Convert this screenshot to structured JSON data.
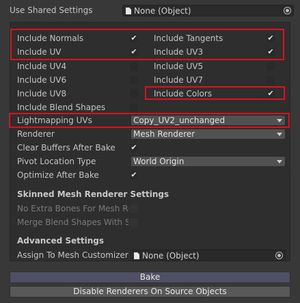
{
  "header": {
    "shared_label": "Use Shared Settings",
    "shared_value": "None (Object)"
  },
  "options": {
    "include_normals": {
      "label": "Include Normals",
      "checked": true
    },
    "include_tangents": {
      "label": "Include Tangents",
      "checked": true
    },
    "include_uv": {
      "label": "Include UV",
      "checked": true
    },
    "include_uv3": {
      "label": "Include UV3",
      "checked": true
    },
    "include_uv4": {
      "label": "Include UV4",
      "checked": false
    },
    "include_uv5": {
      "label": "Include UV5",
      "checked": false
    },
    "include_uv6": {
      "label": "Include UV6",
      "checked": false
    },
    "include_uv7": {
      "label": "Include UV7",
      "checked": false
    },
    "include_uv8": {
      "label": "Include UV8",
      "checked": false
    },
    "include_colors": {
      "label": "Include Colors",
      "checked": true
    },
    "include_blend_shapes": {
      "label": "Include Blend Shapes",
      "checked": false
    },
    "lightmapping_uvs": {
      "label": "Lightmapping UVs",
      "value": "Copy_UV2_unchanged"
    },
    "renderer": {
      "label": "Renderer",
      "value": "Mesh Renderer"
    },
    "clear_buffers": {
      "label": "Clear Buffers After Bake",
      "checked": true
    },
    "pivot_location": {
      "label": "Pivot Location Type",
      "value": "World Origin"
    },
    "optimize_after_bake": {
      "label": "Optimize After Bake",
      "checked": true
    }
  },
  "skinned": {
    "title": "Skinned Mesh Renderer Settings",
    "no_extra_bones": "No Extra Bones For Mesh Rer",
    "merge_blend_shapes": "Merge Blend Shapes With Sa"
  },
  "advanced": {
    "title": "Advanced Settings",
    "assign_label": "Assign To Mesh Customizer",
    "assign_value": "None (Object)"
  },
  "buttons": {
    "bake": "Bake",
    "disable": "Disable Renderers On Source Objects"
  },
  "check_glyph": "✔",
  "colors": {
    "highlight": "#e0101c",
    "background": "#383838",
    "panel": "#2e2e2e"
  }
}
